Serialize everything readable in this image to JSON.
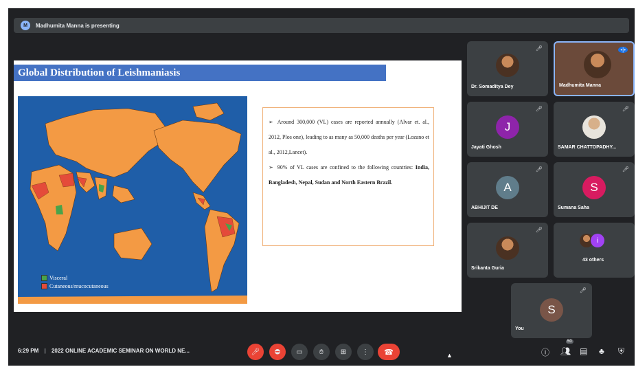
{
  "presenting_banner": {
    "avatar_letter": "M",
    "text": "Madhumita Manna is presenting"
  },
  "slide": {
    "title": "Global Distribution of Leishmaniasis",
    "legend": [
      {
        "label": "Visceral",
        "color": "#49a34a"
      },
      {
        "label": "Cutaneous/mucocutaneous",
        "color": "#e44b3a"
      }
    ],
    "bullets": [
      {
        "text": "Around 300,000 (VL) cases are reported annually (Alvar et. al., 2012, Plos one), leading to as many as 50,000 deaths per year (Lozano et al., 2012,Lancet)."
      },
      {
        "text": "90% of VL cases are confined to the following countries: ",
        "bold": "India, Bangladesh, Nepal, Sudan and North Eastern Brazil."
      }
    ]
  },
  "participants": [
    {
      "name": "Dr. Somaditya Dey",
      "type": "photo"
    },
    {
      "name": "Madhumita Manna",
      "type": "photo",
      "speaking": true
    },
    {
      "name": "Jayati Ghosh",
      "type": "letter",
      "letter": "J",
      "color": "#8e24aa"
    },
    {
      "name": "SAMAR CHATTOPADHY...",
      "type": "photo"
    },
    {
      "name": "ABHIJIT DE",
      "type": "letter",
      "letter": "A",
      "color": "#607d8b"
    },
    {
      "name": "Sumana Saha",
      "type": "letter",
      "letter": "S",
      "color": "#d81b60"
    },
    {
      "name": "Srikanta Guria",
      "type": "photo"
    },
    {
      "name": "43 others",
      "type": "others",
      "letter": "i"
    },
    {
      "name": "You",
      "type": "letter",
      "letter": "S",
      "color": "#795548"
    }
  ],
  "bottom_bar": {
    "time": "6:29 PM",
    "separator": "|",
    "meeting_title": "2022 ONLINE ACADEMIC SEMINAR ON WORLD NE...",
    "people_count": "50"
  },
  "colors": {
    "background": "#202124",
    "tile": "#3c4043",
    "danger": "#ea4335",
    "map_ocean": "#1f5ea8",
    "map_land": "#f39a44"
  }
}
